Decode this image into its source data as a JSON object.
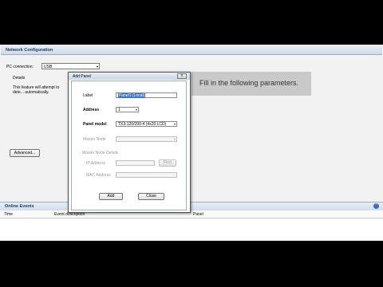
{
  "network": {
    "title": "Network Configuration",
    "pc_connection_label": "PC connection:",
    "pc_connection_value": "USB",
    "details_label": "Details",
    "details_text": "This feature will attempt to dete... automatically.",
    "advanced_button": "Advanced..."
  },
  "instruction": {
    "text": "Fill in the following parameters."
  },
  "dialog": {
    "title": "Add Panel",
    "close_glyph": "x",
    "label_label": "Label",
    "label_value": "Panel1 (Local)",
    "address_label": "Address",
    "address_value": "1",
    "panel_model_label": "Panel model",
    "panel_model_value": "TX3-120/200-4 (4x20 LCD)",
    "master_node_label": "Master Node",
    "master_node_value": "",
    "master_node_details_label": "Master Node Details",
    "ip_address_label": "IP Address",
    "ip_address_value": "",
    "find_button": "Find",
    "mac_address_label": "MAC Address",
    "mac_address_value": "",
    "add_button": "Add",
    "close_button": "Close"
  },
  "events": {
    "title": "Online Events",
    "col_time": "Time",
    "col_event": "Event description",
    "col_panel": "Panel"
  },
  "icons": {
    "collapse": "chevron-up-icon",
    "dropdown": "chevron-down-icon"
  }
}
